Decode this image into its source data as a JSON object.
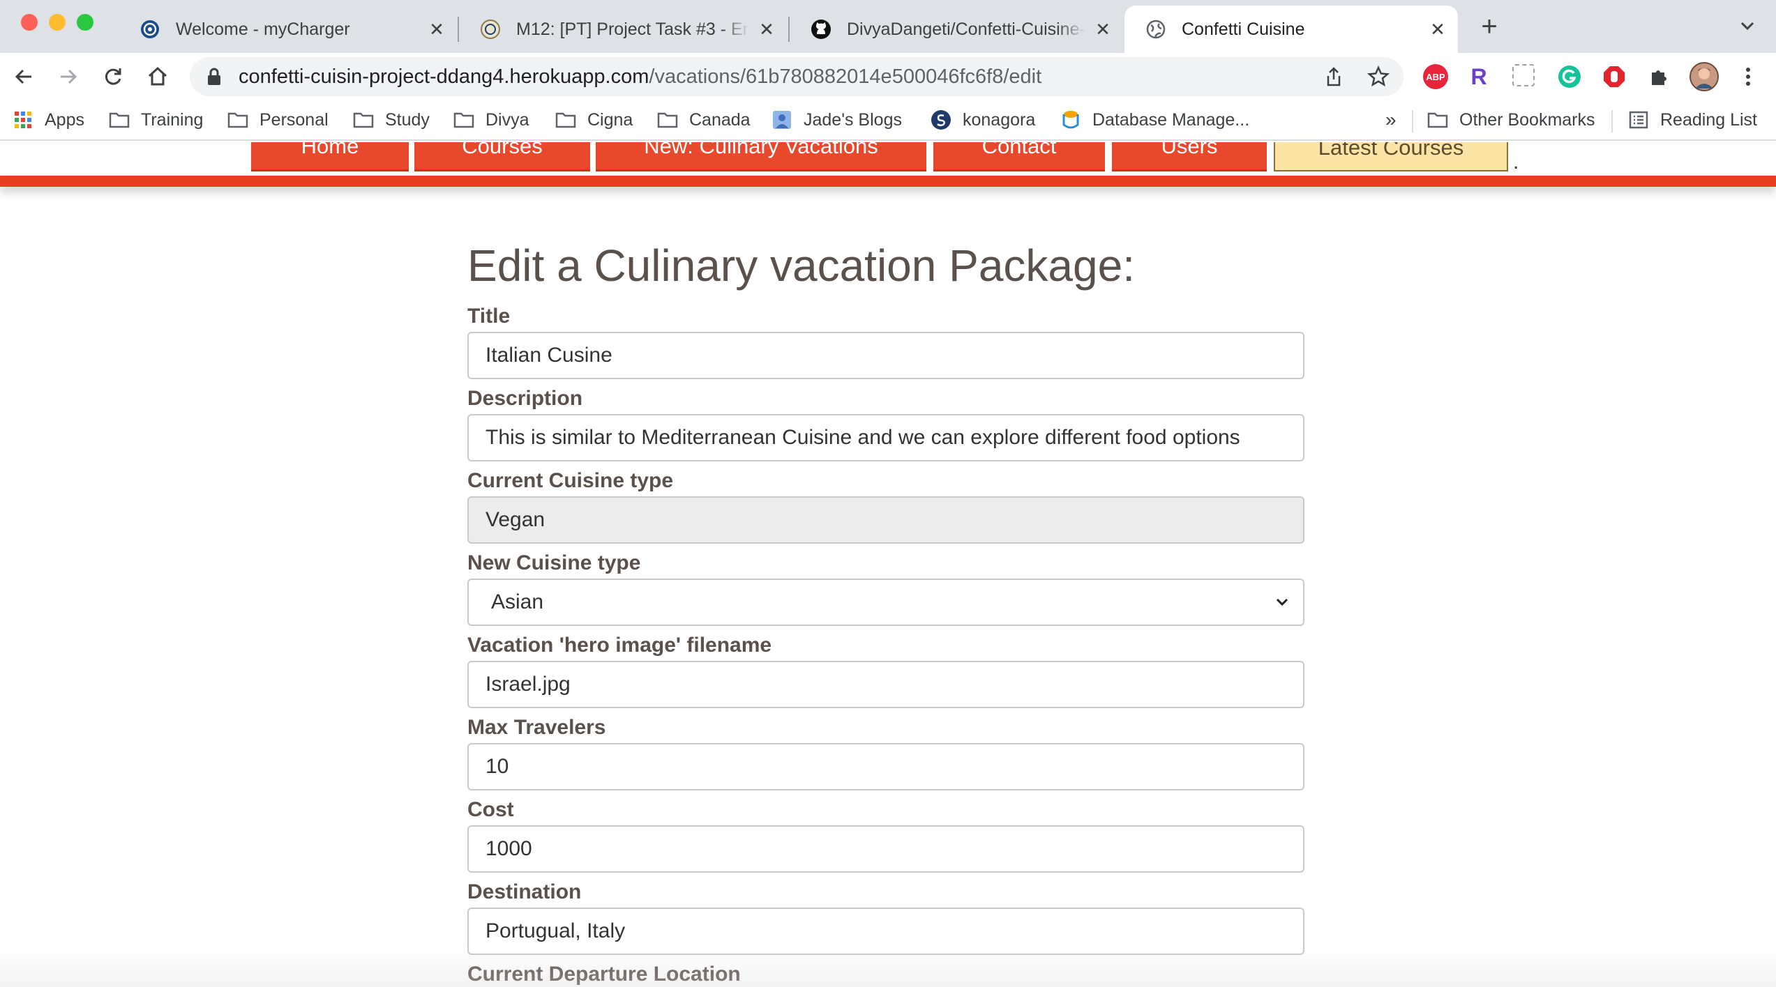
{
  "browser": {
    "tabs": [
      {
        "title": "Welcome - myCharger",
        "icon": "mycharger-icon",
        "active": false
      },
      {
        "title": "M12: [PT] Project Task #3 - En",
        "icon": "university-seal-icon",
        "active": false
      },
      {
        "title": "DivyaDangeti/Confetti-Cuisine-",
        "icon": "github-icon",
        "active": false
      },
      {
        "title": "Confetti Cuisine",
        "icon": "globe-icon",
        "active": true
      }
    ],
    "tab_close_glyph": "✕",
    "new_tab_glyph": "+",
    "url_host": "confetti-cuisin-project-ddang4.herokuapp.com",
    "url_path": "/vacations/61b780882014e500046fc6f8/edit",
    "bookmarks": [
      {
        "label": "Apps",
        "icon": "apps-grid-icon"
      },
      {
        "label": "Training",
        "icon": "folder-icon"
      },
      {
        "label": "Personal",
        "icon": "folder-icon"
      },
      {
        "label": "Study",
        "icon": "folder-icon"
      },
      {
        "label": "Divya",
        "icon": "folder-icon"
      },
      {
        "label": "Cigna",
        "icon": "folder-icon"
      },
      {
        "label": "Canada",
        "icon": "folder-icon"
      },
      {
        "label": "Jade's Blogs",
        "icon": "blog-icon"
      },
      {
        "label": "konagora",
        "icon": "konagora-icon"
      },
      {
        "label": "Database Manage...",
        "icon": "database-icon"
      }
    ],
    "bookmarks_overflow": "»",
    "other_bookmarks": "Other Bookmarks",
    "reading_list": "Reading List",
    "extensions": [
      "abp-icon",
      "r-extension-icon",
      "clipboard-icon",
      "grammarly-icon",
      "adblock-icon",
      "puzzle-icon",
      "profile-avatar-icon",
      "more-menu-icon"
    ],
    "ext_abp_text": "ABP",
    "ext_r_text": "R",
    "colors": {
      "tabstrip": "#dee1e6",
      "omnibox": "#f1f3f4"
    }
  },
  "site": {
    "nav": [
      {
        "label": "Home"
      },
      {
        "label": "Courses"
      },
      {
        "label": "New:   Culinary Vacations"
      },
      {
        "label": "Contact"
      },
      {
        "label": "Users"
      },
      {
        "label": "Latest Courses"
      }
    ],
    "nav_trailing": ".",
    "colors": {
      "nav_button": "#e8482c",
      "accent_bar": "#ea3e22",
      "latest_button": "#fbe4a6",
      "text": "#5a504c"
    }
  },
  "form": {
    "heading": "Edit a Culinary vacation Package:",
    "fields": [
      {
        "label": "Title",
        "value": "Italian Cusine"
      },
      {
        "label": "Description",
        "value": "This is similar to Mediterranean Cuisine and we can explore different food options"
      },
      {
        "label": "Current Cuisine type",
        "value": "Vegan"
      },
      {
        "label": "New Cuisine type",
        "value": "Asian"
      },
      {
        "label": "Vacation 'hero image' filename",
        "value": "Israel.jpg"
      },
      {
        "label": "Max Travelers",
        "value": "10"
      },
      {
        "label": "Cost",
        "value": "1000"
      },
      {
        "label": "Destination",
        "value": "Portugual, Italy"
      },
      {
        "label": "Current Departure Location",
        "value": ""
      }
    ]
  }
}
